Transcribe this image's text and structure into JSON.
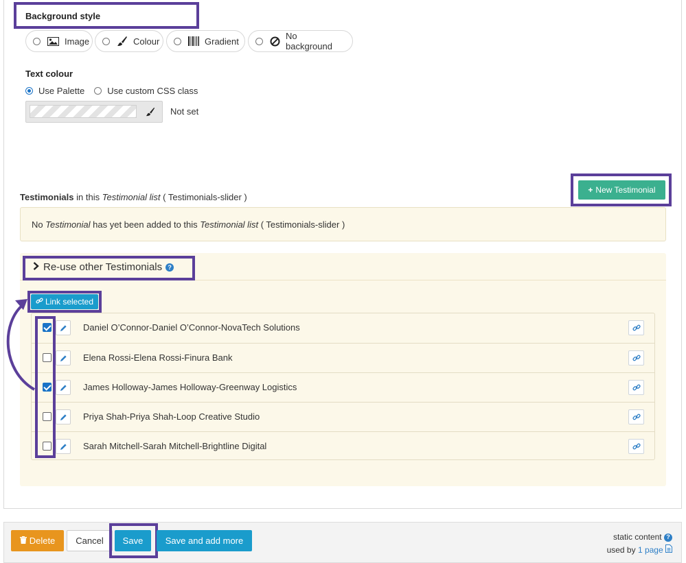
{
  "background_style": {
    "title": "Background style",
    "options": [
      {
        "label": "Image",
        "icon": "image-icon"
      },
      {
        "label": "Colour",
        "icon": "brush-icon"
      },
      {
        "label": "Gradient",
        "icon": "barcode-gradient-icon"
      },
      {
        "label": "No background",
        "icon": "ban-icon"
      }
    ]
  },
  "text_colour": {
    "title": "Text colour",
    "options": [
      {
        "label": "Use Palette",
        "selected": true
      },
      {
        "label": "Use custom CSS class",
        "selected": false
      }
    ],
    "value_label": "Not set"
  },
  "testimonials": {
    "heading_bold": "Testimonials",
    "heading_in": "in this",
    "heading_italic": "Testimonial list",
    "heading_name": "( Testimonials-slider )",
    "new_button": "New Testimonial",
    "notice_prefix": "No",
    "notice_italic1": "Testimonial",
    "notice_mid": "has yet been added to this",
    "notice_italic2": "Testimonial list",
    "notice_suffix": "( Testimonials-slider )"
  },
  "reuse": {
    "title": "Re-use other Testimonials",
    "link_selected": "Link selected",
    "items": [
      {
        "label": "Daniel O’Connor-Daniel O’Connor-NovaTech Solutions",
        "checked": true
      },
      {
        "label": "Elena Rossi-Elena Rossi-Finura Bank",
        "checked": false
      },
      {
        "label": "James Holloway-James Holloway-Greenway Logistics",
        "checked": true
      },
      {
        "label": "Priya Shah-Priya Shah-Loop Creative Studio",
        "checked": false
      },
      {
        "label": "Sarah Mitchell-Sarah Mitchell-Brightline Digital",
        "checked": false
      }
    ]
  },
  "footer": {
    "delete": "Delete",
    "cancel": "Cancel",
    "save": "Save",
    "save_add": "Save and add more",
    "static_content": "static content",
    "used_by": "used by",
    "page_link": "1 page"
  },
  "colors": {
    "highlight": "#5b3f9a",
    "primary": "#1a9ccc",
    "success": "#3bb08f",
    "warning": "#e8951e",
    "panel_bg": "#fcf8e9"
  }
}
